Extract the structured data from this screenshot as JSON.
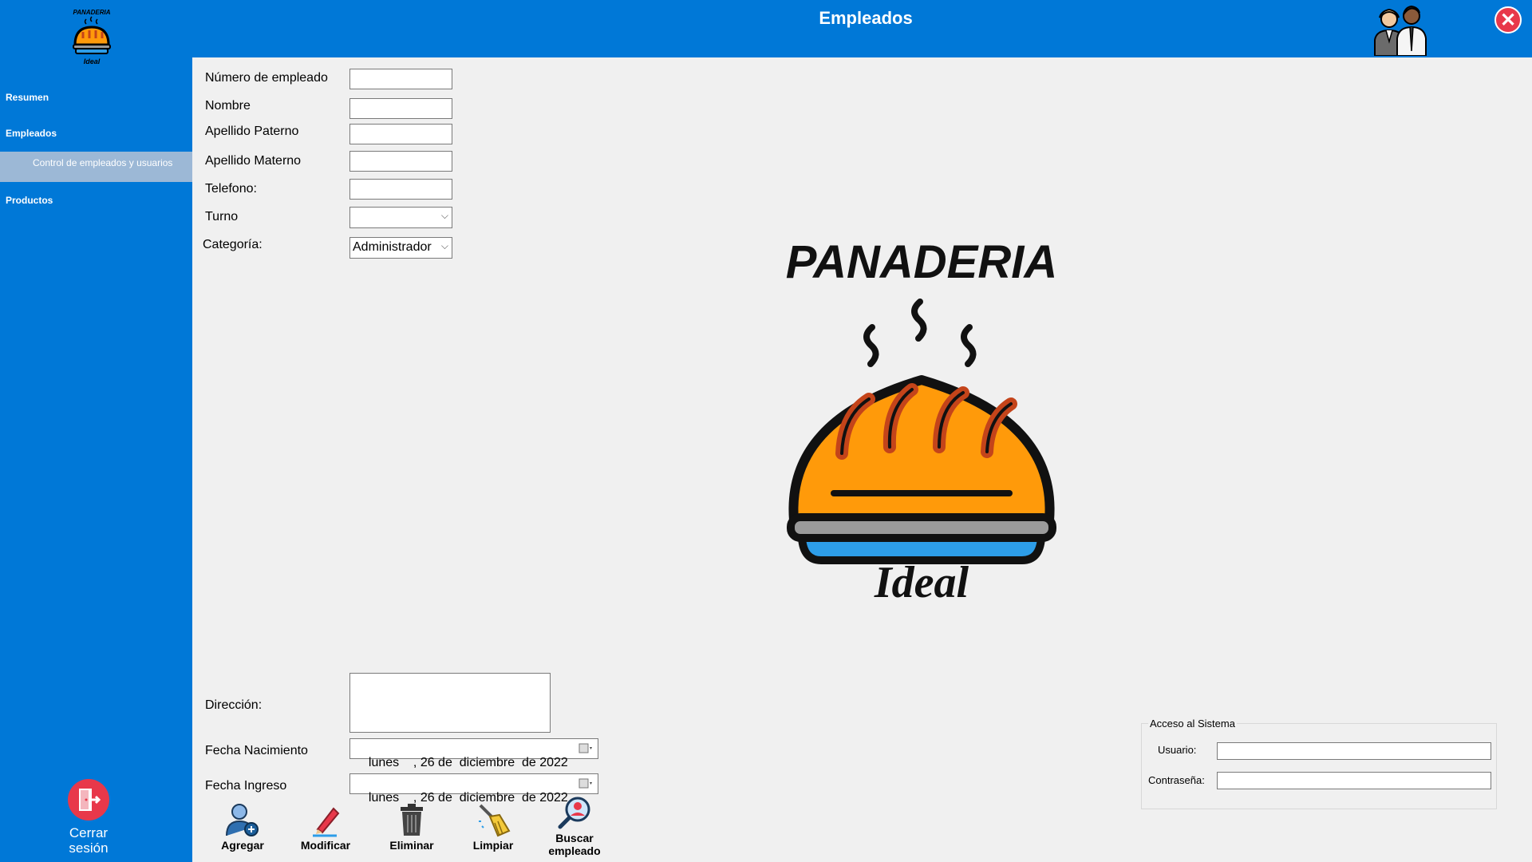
{
  "header": {
    "title": "Empleados",
    "close_label": "✕"
  },
  "sidebar": {
    "items": [
      {
        "label": "Resumen"
      },
      {
        "label": "Empleados"
      },
      {
        "label": "Control de empleados y usuarios"
      },
      {
        "label": "Productos"
      }
    ],
    "logout_label": "Cerrar sesión"
  },
  "form": {
    "numero_label": "Número de empleado",
    "nombre_label": "Nombre",
    "apellido_paterno_label": "Apellido Paterno",
    "apellido_materno_label": "Apellido Materno",
    "telefono_label": "Telefono:",
    "turno_label": "Turno",
    "turno_value": "",
    "categoria_label": "Categoría:",
    "categoria_value": "Administrador",
    "direccion_label": "Dirección:",
    "fecha_nacimiento_label": "Fecha Nacimiento",
    "fecha_nacimiento_value": "lunes    , 26 de  diciembre  de 2022",
    "fecha_ingreso_label": "Fecha Ingreso",
    "fecha_ingreso_value": "lunes    , 26 de  diciembre  de 2022"
  },
  "actions": {
    "agregar": "Agregar",
    "modificar": "Modificar",
    "eliminar": "Eliminar",
    "limpiar": "Limpiar",
    "buscar_line1": "Buscar",
    "buscar_line2": "empleado"
  },
  "access": {
    "title": "Acceso al Sistema",
    "usuario_label": "Usuario:",
    "contrasena_label": "Contraseña:"
  },
  "logo": {
    "line1": "PANADERIA",
    "line2": "Ideal"
  },
  "colors": {
    "brand_blue": "#0078d7",
    "close_red": "#e8384a",
    "selected_nav": "#9cb8d6",
    "bread_orange": "#ff9a0a"
  }
}
